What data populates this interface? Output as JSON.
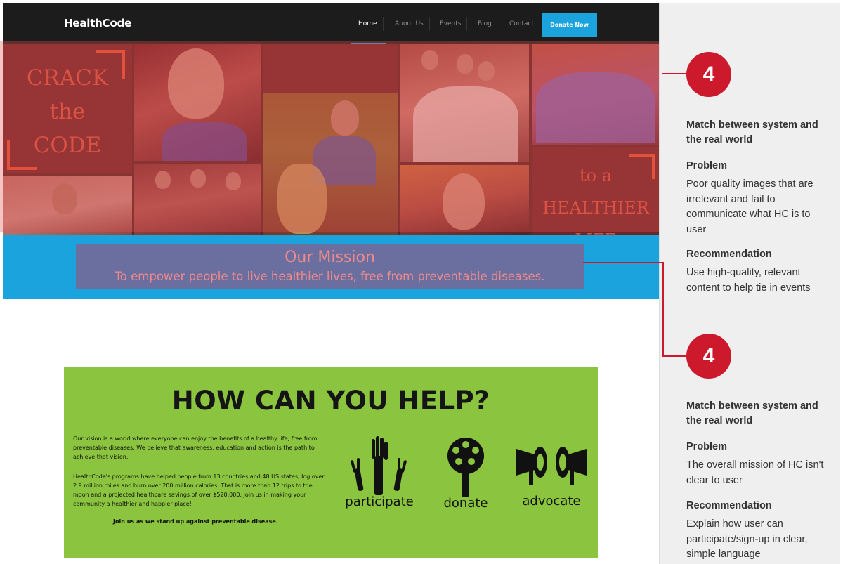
{
  "site": {
    "logo": "HealthCode",
    "nav": [
      "Home",
      "About Us",
      "Events",
      "Blog",
      "Contact"
    ],
    "donate_button": "Donate Now",
    "hero": {
      "crack_lines": [
        "CRACK",
        "the",
        "CODE"
      ],
      "healthier_lines": [
        "to a",
        "HEALTHIER",
        "LIFE"
      ]
    },
    "mission": {
      "title": "Our Mission",
      "text": "To empower people to live healthier lives, free from preventable diseases."
    },
    "help": {
      "title": "HOW CAN YOU HELP?",
      "paragraph1": "Our vision is a world where everyone can enjoy the benefits of a healthy life, free from preventable diseases. We believe that awareness, education and action is the path to achieve that vision.",
      "paragraph2": "HealthCode's programs have helped people from 13 countries and 48 US states, log over 2.9 million miles and burn over 200 million calories. That is more than 12 trips to the moon and a projected healthcare savings of over $520,000. Join us in making your community a healthier and happier place!",
      "join": "Join us as we stand up against preventable disease.",
      "actions": [
        "participate",
        "donate",
        "advocate"
      ]
    }
  },
  "annotations": [
    {
      "number": "4",
      "heading": "Match between system and the real world",
      "problem_label": "Problem",
      "problem": "Poor quality images that are irrelevant and fail to communicate what HC is to user",
      "recommendation_label": "Recommendation",
      "recommendation": "Use high-quality, relevant content to help tie in events"
    },
    {
      "number": "4",
      "heading": "Match between system and the real world",
      "problem_label": "Problem",
      "problem": "The overall mission of HC isn't clear to user",
      "recommendation_label": "Recommendation",
      "recommendation": "Explain how user can participate/sign-up in clear, simple language"
    }
  ],
  "colors": {
    "accent_blue": "#1aa3dd",
    "badge_red": "#cc1a2c",
    "help_green": "#8bc43f",
    "nav_dark": "#1c1c1c"
  }
}
